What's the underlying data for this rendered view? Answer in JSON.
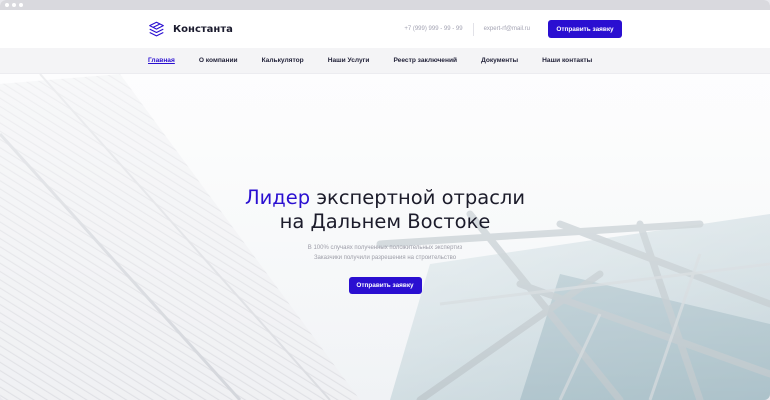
{
  "brand": {
    "name": "Константа"
  },
  "header": {
    "phone": "+7 (999) 999 - 99 - 99",
    "email": "expert-rf@mail.ru",
    "cta_label": "Отправить заявку"
  },
  "nav": {
    "items": [
      {
        "label": "Главная",
        "active": true
      },
      {
        "label": "О компании"
      },
      {
        "label": "Калькулятор"
      },
      {
        "label": "Наши Услуги"
      },
      {
        "label": "Реестр заключений"
      },
      {
        "label": "Документы"
      },
      {
        "label": "Наши контакты"
      }
    ]
  },
  "hero": {
    "title_accent": "Лидер",
    "title_rest": "экспертной отрасли",
    "title_line2": "на Дальнем Востоке",
    "subtitle": "В 100% случаях полученных положительных экспертиз Заказчики получили разрешения на строительство",
    "cta_label": "Отправить заявку"
  },
  "colors": {
    "accent": "#2a0fd1",
    "text": "#1c1c2b",
    "muted": "#9d9da8"
  },
  "icons": {
    "logo": "stacked-layers-logo-icon"
  }
}
